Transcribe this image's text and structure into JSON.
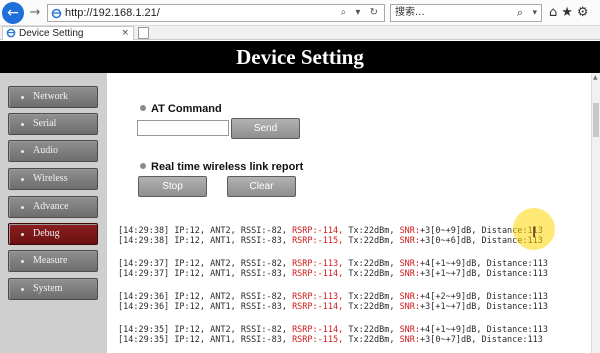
{
  "browser": {
    "url": "http://192.168.1.21/",
    "search_text": "搜索...",
    "tab_title": "Device Setting",
    "back_glyph": "←",
    "forward_glyph": "→",
    "url_icons_glyphs": "⌕ ▾ ↻",
    "search_glyph": "⌕",
    "search_drop_glyph": "▾",
    "toolbar_glyphs": "⌂★⚙",
    "tab_close_glyph": "×"
  },
  "header": {
    "title": "Device Setting"
  },
  "sidebar": {
    "items": [
      {
        "label": "Network",
        "active": false
      },
      {
        "label": "Serial",
        "active": false
      },
      {
        "label": "Audio",
        "active": false
      },
      {
        "label": "Wireless",
        "active": false
      },
      {
        "label": "Advance",
        "active": false
      },
      {
        "label": "Debug",
        "active": true
      },
      {
        "label": "Measure",
        "active": false
      },
      {
        "label": "System",
        "active": false
      }
    ]
  },
  "at_command": {
    "heading": "AT Command",
    "input_value": "",
    "send_label": "Send"
  },
  "link_report": {
    "heading": "Real time wireless link report",
    "stop_label": "Stop",
    "clear_label": "Clear"
  },
  "log": {
    "lines": [
      {
        "time": "[14:29:38]",
        "ip": "IP:12,",
        "ant": "ANT2,",
        "rssi": "RSSI:-82,",
        "rsrp": "RSRP:-114,",
        "tx": "Tx:22dBm,",
        "snr": "SNR:",
        "snr_val": "+3[0~+9]dB,",
        "dist": "Distance:113"
      },
      {
        "time": "[14:29:38]",
        "ip": "IP:12,",
        "ant": "ANT1,",
        "rssi": "RSSI:-83,",
        "rsrp": "RSRP:-115,",
        "tx": "Tx:22dBm,",
        "snr": "SNR:",
        "snr_val": "+3[0~+6]dB,",
        "dist": "Distance:113"
      },
      {
        "time": "[14:29:37]",
        "ip": "IP:12,",
        "ant": "ANT2,",
        "rssi": "RSSI:-82,",
        "rsrp": "RSRP:-113,",
        "tx": "Tx:22dBm,",
        "snr": "SNR:",
        "snr_val": "+4[+1~+9]dB,",
        "dist": "Distance:113"
      },
      {
        "time": "[14:29:37]",
        "ip": "IP:12,",
        "ant": "ANT1,",
        "rssi": "RSSI:-83,",
        "rsrp": "RSRP:-114,",
        "tx": "Tx:22dBm,",
        "snr": "SNR:",
        "snr_val": "+3[+1~+7]dB,",
        "dist": "Distance:113"
      },
      {
        "time": "[14:29:36]",
        "ip": "IP:12,",
        "ant": "ANT2,",
        "rssi": "RSSI:-82,",
        "rsrp": "RSRP:-113,",
        "tx": "Tx:22dBm,",
        "snr": "SNR:",
        "snr_val": "+4[+2~+9]dB,",
        "dist": "Distance:113"
      },
      {
        "time": "[14:29:36]",
        "ip": "IP:12,",
        "ant": "ANT1,",
        "rssi": "RSSI:-83,",
        "rsrp": "RSRP:-114,",
        "tx": "Tx:22dBm,",
        "snr": "SNR:",
        "snr_val": "+3[+1~+7]dB,",
        "dist": "Distance:113"
      },
      {
        "time": "[14:29:35]",
        "ip": "IP:12,",
        "ant": "ANT2,",
        "rssi": "RSSI:-82,",
        "rsrp": "RSRP:-114,",
        "tx": "Tx:22dBm,",
        "snr": "SNR:",
        "snr_val": "+4[+1~+9]dB,",
        "dist": "Distance:113"
      },
      {
        "time": "[14:29:35]",
        "ip": "IP:12,",
        "ant": "ANT1,",
        "rssi": "RSSI:-83,",
        "rsrp": "RSRP:-115,",
        "tx": "Tx:22dBm,",
        "snr": "SNR:",
        "snr_val": "+3[0~+7]dB,",
        "dist": "Distance:113"
      }
    ]
  },
  "colors": {
    "header_bg": "#000000",
    "sidebar_bg": "#cfcfcf",
    "nav_active": "#7a1616",
    "log_red": "#d11a1a",
    "cursor_highlight": "#ffd600"
  },
  "icons": {
    "back": "back-arrow-icon",
    "forward": "forward-arrow-icon",
    "favicon": "ie-favicon-icon",
    "cursor": "text-cursor-icon"
  }
}
